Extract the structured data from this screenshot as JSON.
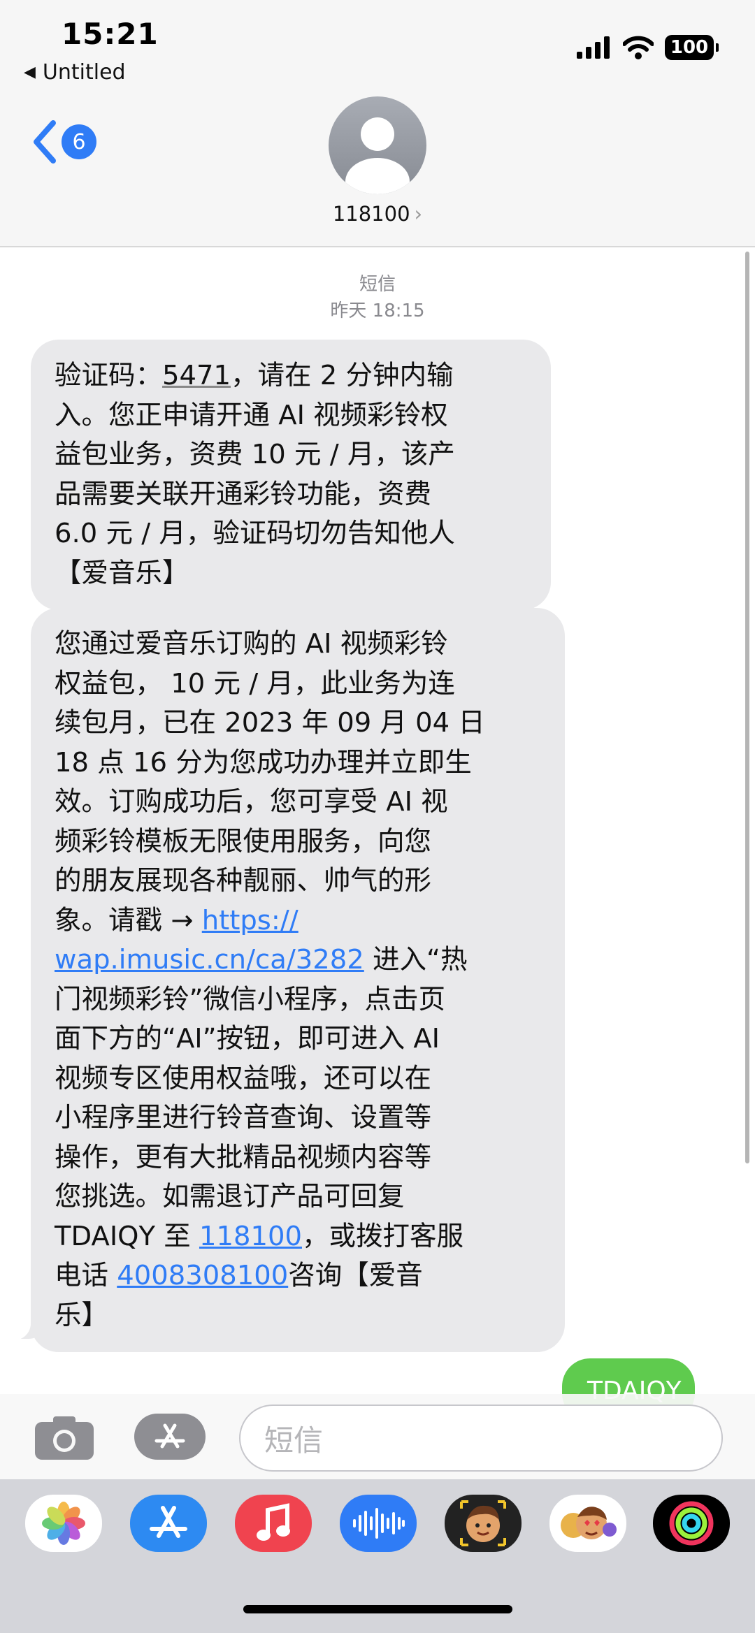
{
  "status": {
    "time": "15:21",
    "battery": "100"
  },
  "nav": {
    "breadcrumb": "Untitled",
    "back_badge": "6"
  },
  "contact": {
    "name": "118100"
  },
  "conversation": {
    "label": "短信",
    "timestamp": "昨天 18:15",
    "messages": [
      {
        "direction": "received",
        "lines": [
          [
            "验证码：",
            "5471",
            "，请在 2 分钟内输"
          ],
          [
            "入。您正申请开通 AI 视频彩铃权"
          ],
          [
            "益包业务，资费 10 元 / 月，该产"
          ],
          [
            "品需要关联开通彩铃功能，资费"
          ],
          [
            "6.0 元 / 月，验证码切勿告知他人"
          ],
          [
            "【爱音乐】"
          ]
        ]
      },
      {
        "direction": "received",
        "lines": [
          [
            "您通过爱音乐订购的 AI 视频彩铃"
          ],
          [
            "权益包， 10 元 / 月，此业务为连"
          ],
          [
            "续包月，已在 2023 年 09 月 04 日"
          ],
          [
            "18 点 16 分为您成功办理并立即生"
          ],
          [
            "效。订购成功后，您可享受 AI 视"
          ],
          [
            "频彩铃模板无限使用服务，向您"
          ],
          [
            "的朋友展现各种靓丽、帅气的形"
          ],
          [
            "象。请戳 → ",
            "https://"
          ],
          [
            "wap.imusic.cn/ca/3282",
            " 进入“热"
          ],
          [
            "门视频彩铃”微信小程序，点击页"
          ],
          [
            "面下方的“AI”按钮，即可进入 AI"
          ],
          [
            "视频专区使用权益哦，还可以在"
          ],
          [
            "小程序里进行铃音查询、设置等"
          ],
          [
            "操作，更有大批精品视频内容等"
          ],
          [
            "您挑选。如需退订产品可回复"
          ],
          [
            "TDAIQY 至 ",
            "118100",
            "，或拨打客服"
          ],
          [
            "电话 ",
            "4008308100",
            "咨询【爱音"
          ],
          [
            "乐】"
          ]
        ]
      },
      {
        "direction": "sent",
        "text": "TDAIQY"
      }
    ]
  },
  "compose": {
    "placeholder": "短信"
  },
  "app_drawer": {
    "apps": [
      {
        "icon": "photos-icon"
      },
      {
        "icon": "app-store-icon"
      },
      {
        "icon": "music-icon"
      },
      {
        "icon": "audio-waveform-icon"
      },
      {
        "icon": "memoji-icon"
      },
      {
        "icon": "memoji-stickers-icon"
      },
      {
        "icon": "activity-icon"
      }
    ]
  },
  "colors": {
    "accent": "#2f7cf6",
    "received_bubble": "#e9e9eb",
    "sent_bubble": "#5fcb4e"
  }
}
